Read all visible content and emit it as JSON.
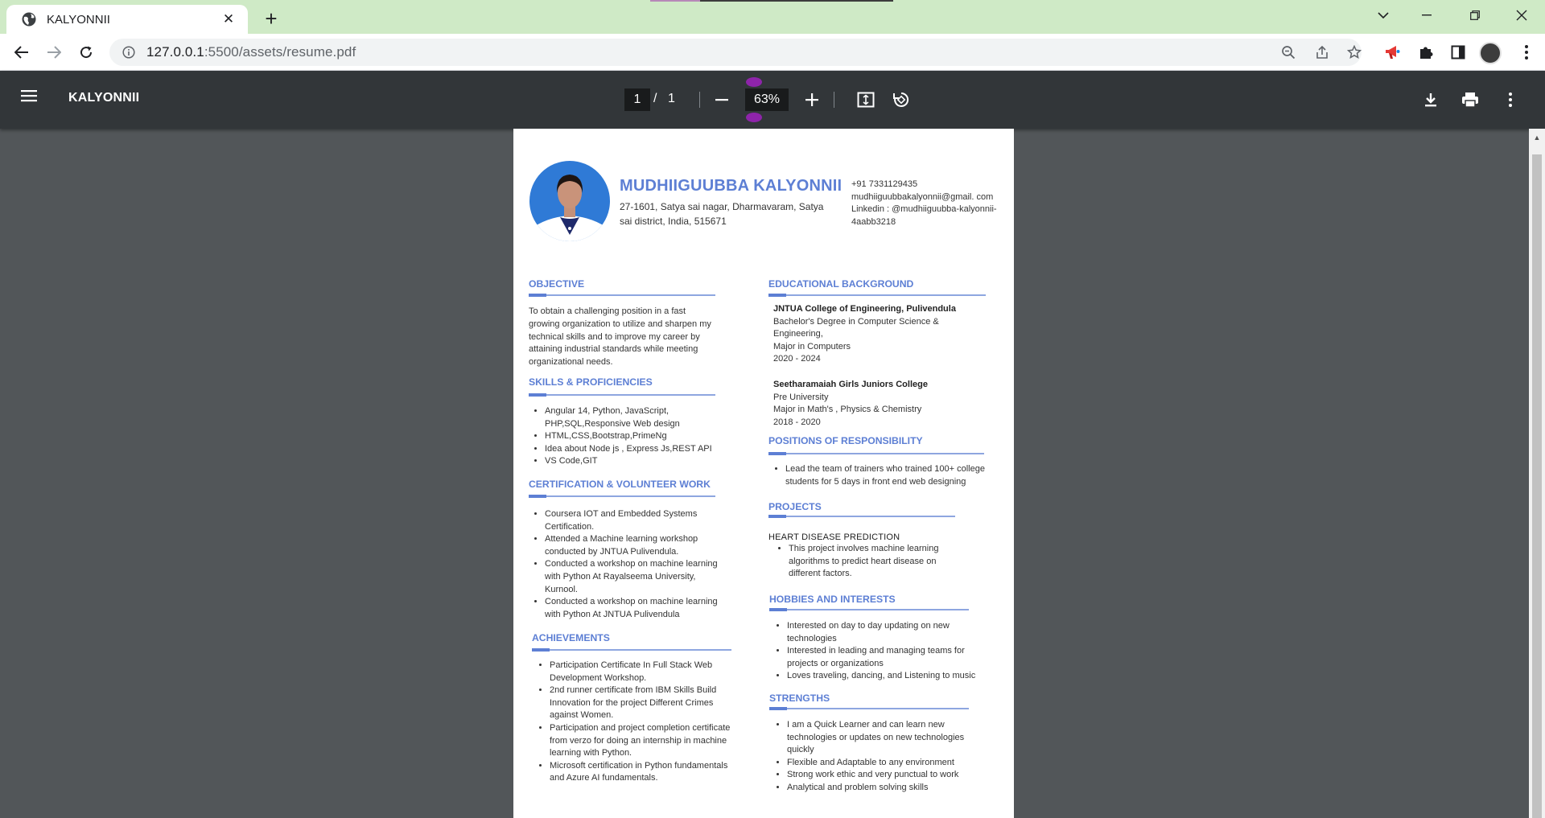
{
  "browser": {
    "tab_title": "KALYONNII",
    "url_host": "127.0.0.1",
    "url_path": ":5500/assets/resume.pdf"
  },
  "viewer": {
    "title": "KALYONNII",
    "page_current": "1",
    "page_sep": "/",
    "page_total": "1",
    "zoom": "63%"
  },
  "resume": {
    "name": "MUDHIIGUUBBA KALYONNII",
    "address": "27-1601, Satya sai nagar, Dharmavaram, Satya sai district, India, 515671",
    "phone": "+91 7331129435",
    "email": "mudhiiguubbakalyonnii@gmail. com",
    "linkedin": "Linkedin : @mudhiiguubba-kalyonnii-4aabb3218",
    "objective": {
      "heading": "OBJECTIVE",
      "text": "To obtain a challenging position in a fast growing organization to utilize and sharpen my technical skills and to improve my career by attaining industrial standards while meeting organizational needs."
    },
    "skills": {
      "heading": "SKILLS & PROFICIENCIES",
      "items": [
        "Angular 14, Python, JavaScript, PHP,SQL,Responsive Web design",
        "HTML,CSS,Bootstrap,PrimeNg",
        "Idea about Node js , Express Js,REST API",
        "VS Code,GIT"
      ]
    },
    "certification": {
      "heading": "CERTIFICATION & VOLUNTEER WORK",
      "items": [
        "Coursera IOT and Embedded Systems Certification.",
        "Attended a Machine learning workshop conducted by JNTUA Pulivendula.",
        "Conducted a workshop on machine learning with Python At Rayalseema University, Kurnool.",
        "Conducted a workshop on machine learning with Python At JNTUA Pulivendula"
      ]
    },
    "achievements": {
      "heading": "ACHIEVEMENTS",
      "items": [
        "Participation Certificate In Full Stack Web Development Workshop.",
        "2nd runner certificate from IBM Skills Build Innovation for the project Different Crimes against Women.",
        "Participation and project completion certificate from verzo for doing an internship in machine learning with Python.",
        "Microsoft certification in Python fundamentals and Azure AI fundamentals."
      ]
    },
    "education": {
      "heading": "EDUCATIONAL BACKGROUND",
      "entries": [
        {
          "institution": "JNTUA College of Engineering, Pulivendula",
          "line1": "Bachelor's Degree in Computer Science & Engineering,",
          "line2": "Major in Computers",
          "years": "2020 - 2024"
        },
        {
          "institution": "Seetharamaiah Girls Juniors College",
          "line1": "Pre University",
          "line2": "Major in Math's , Physics & Chemistry",
          "years": "2018 - 2020"
        }
      ]
    },
    "positions": {
      "heading": "POSITIONS OF RESPONSIBILITY",
      "items": [
        "Lead the team of trainers who trained 100+ college students for 5 days in front end web designing"
      ]
    },
    "projects": {
      "heading": "PROJECTS",
      "title": "HEART DISEASE PREDICTION",
      "items": [
        "This project involves machine learning algorithms to predict heart disease on different factors."
      ]
    },
    "hobbies": {
      "heading": "HOBBIES AND INTERESTS",
      "items": [
        "Interested on day to day updating on new technologies",
        "Interested in leading and managing teams for projects or organizations",
        "Loves traveling, dancing, and Listening to music"
      ]
    },
    "strengths": {
      "heading": "STRENGTHS",
      "items": [
        "I am a Quick Learner and can learn new technologies or updates on new technologies quickly",
        "Flexible and Adaptable to any environment",
        "Strong work ethic and very punctual to work",
        "Analytical and problem solving skills"
      ]
    }
  }
}
